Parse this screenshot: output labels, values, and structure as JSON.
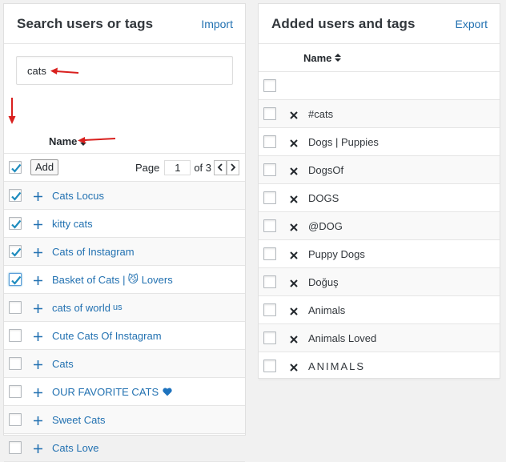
{
  "left": {
    "title": "Search users or tags",
    "import_label": "Import",
    "search_value": "cats",
    "column_name": "Name",
    "add_label": "Add",
    "page_label": "Page",
    "page_value": "1",
    "page_of": "of 3",
    "results": [
      {
        "label": "Cats Locus",
        "checked": true
      },
      {
        "label": "kitty cats",
        "checked": true
      },
      {
        "label": "Cats of Instagram",
        "checked": true
      },
      {
        "label": "Basket of Cats | ",
        "emoji": "😼",
        "suffix": " Lovers",
        "checked": true
      },
      {
        "label": "cats of world",
        "sub": "us",
        "checked": false
      },
      {
        "label": "Cute Cats Of Instagram",
        "checked": false
      },
      {
        "label": "Cats",
        "checked": false
      },
      {
        "label": "OUR FAVORITE CATS",
        "heart": true,
        "checked": false
      },
      {
        "label": "Sweet Cats",
        "checked": false
      },
      {
        "label": "Cats Love",
        "checked": false
      }
    ]
  },
  "right": {
    "title": "Added users and tags",
    "export_label": "Export",
    "column_name": "Name",
    "items": [
      "#cats",
      "Dogs | Puppies",
      "DogsOf",
      "DOGS",
      "@DOG",
      "Puppy Dogs",
      "Doğuş",
      "Animals",
      "Animals Loved",
      "ANIMALS"
    ]
  },
  "colors": {
    "link": "#2271b1",
    "arrow": "#d9201e"
  },
  "icons": [
    "plus-icon",
    "x-icon",
    "checkmark-icon",
    "sort-icon",
    "chevron-left-icon",
    "chevron-right-icon",
    "heart-icon",
    "cat-emoji-icon"
  ]
}
